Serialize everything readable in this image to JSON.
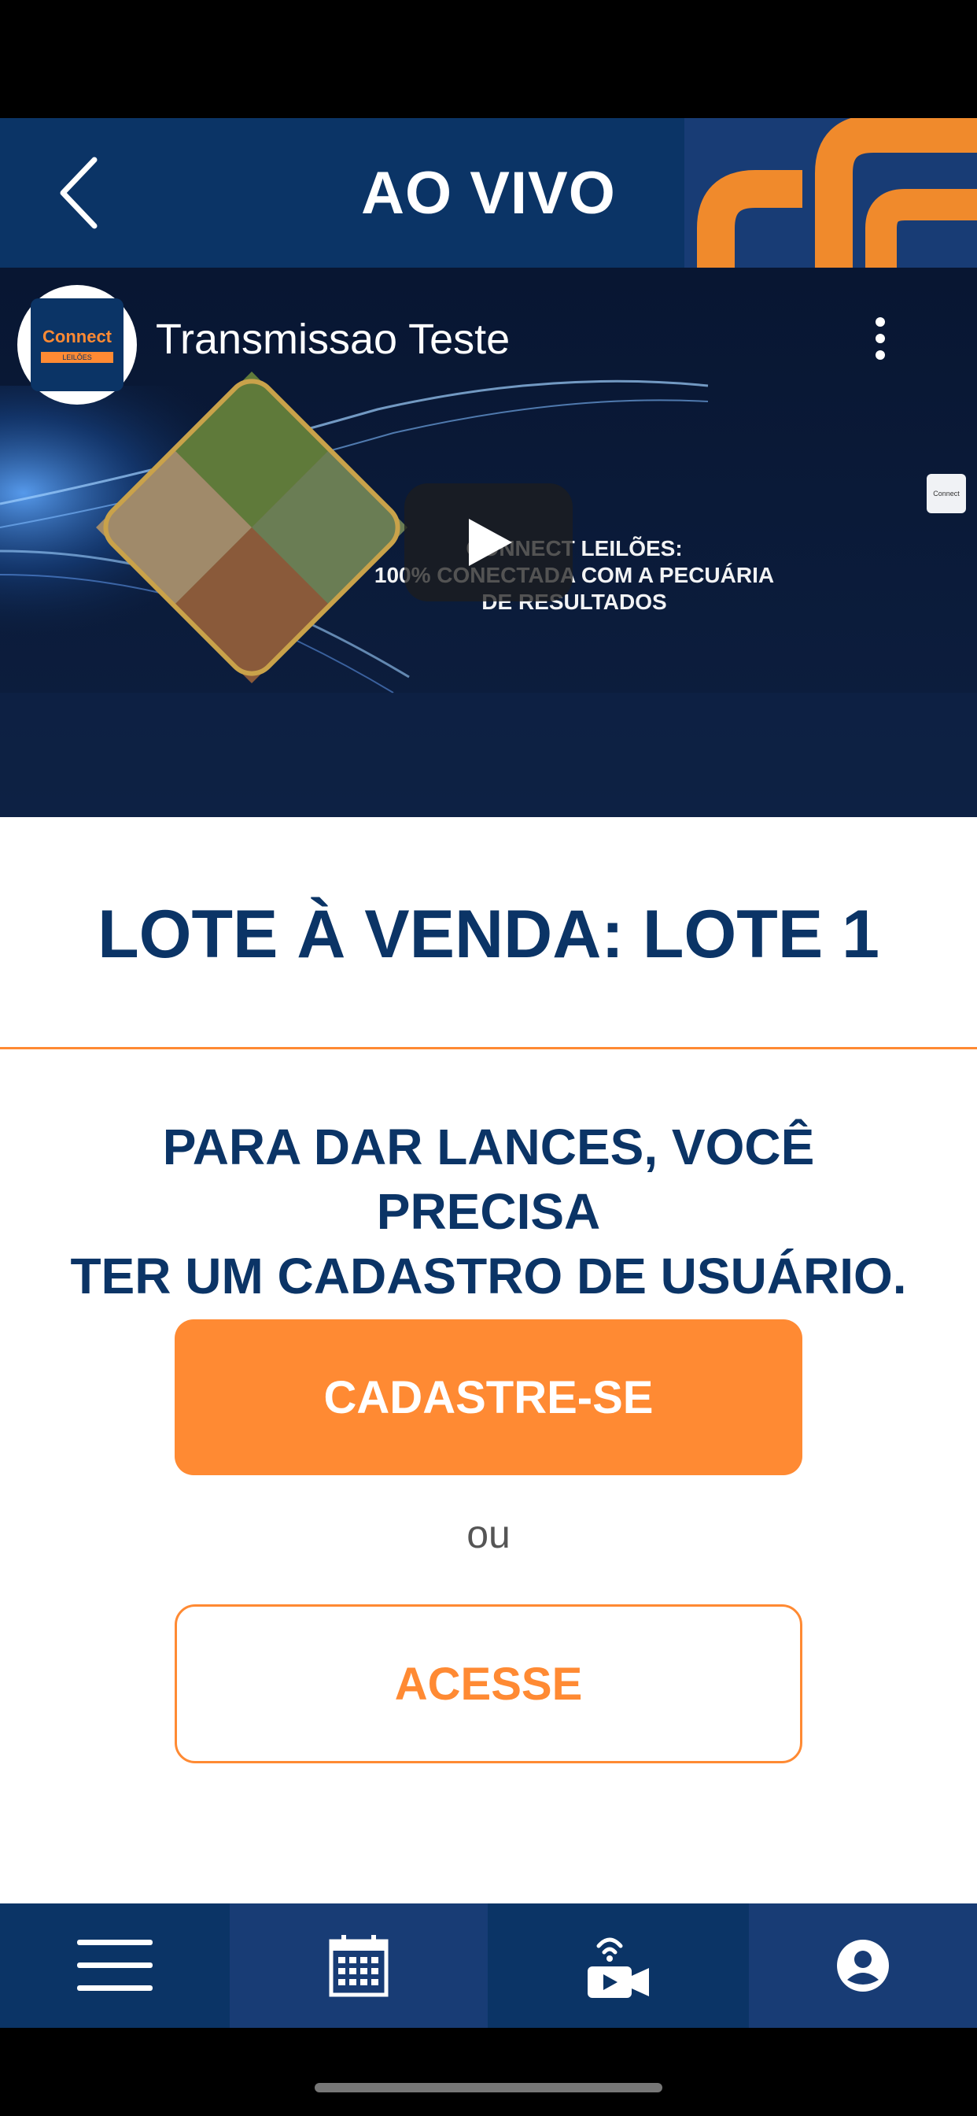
{
  "header": {
    "title": "AO VIVO"
  },
  "video": {
    "channel_name": "Transmissao Teste",
    "channel_logo_text": "Connect",
    "channel_logo_sub": "LEILÕES",
    "mini_logo_text": "Connect",
    "caption_line1": "CONNECT LEILÕES:",
    "caption_line2": "100% CONECTADA COM A PECUÁRIA",
    "caption_line3": "DE RESULTADOS"
  },
  "lot": {
    "title": "LOTE À VENDA: LOTE 1"
  },
  "auth": {
    "message_line1": "PARA DAR LANCES, VOCÊ PRECISA",
    "message_line2": "TER UM CADASTRO DE USUÁRIO.",
    "register_label": "CADASTRE-SE",
    "or_label": "ou",
    "login_label": "ACESSE"
  },
  "bottom_nav": [
    {
      "icon": "menu-icon"
    },
    {
      "icon": "calendar-icon"
    },
    {
      "icon": "live-camera-icon"
    },
    {
      "icon": "profile-icon"
    }
  ],
  "colors": {
    "navy": "#0b3466",
    "navy_alt": "#183c75",
    "orange": "#ff8a33"
  }
}
